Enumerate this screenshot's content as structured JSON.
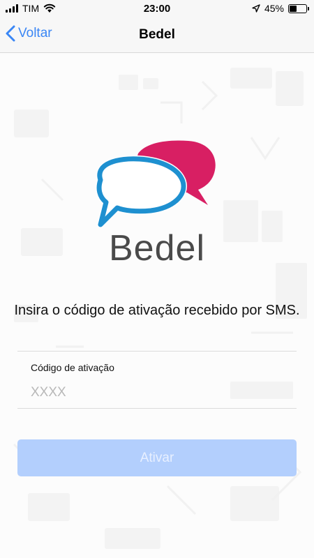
{
  "status_bar": {
    "carrier": "TIM",
    "time": "23:00",
    "battery_text": "45%",
    "battery_level": 0.45,
    "icons": [
      "signal-icon",
      "wifi-icon",
      "location-arrow-icon",
      "battery-icon"
    ]
  },
  "nav": {
    "back_label": "Voltar",
    "title": "Bedel"
  },
  "logo": {
    "text": "Bedel",
    "colors": {
      "blue_bubble": "#1e90d0",
      "pink_bubble": "#d81f63",
      "text": "#4a4a4a"
    }
  },
  "instruction": "Insira o código de ativação recebido por SMS.",
  "form": {
    "label": "Código de ativação",
    "placeholder": "XXXX",
    "value": ""
  },
  "activate_button": {
    "label": "Ativar",
    "color": "#b3cffd"
  },
  "accent_color": "#3a86f5"
}
